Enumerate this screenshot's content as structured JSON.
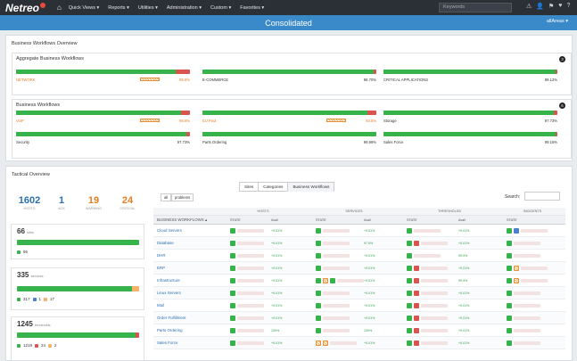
{
  "nav": {
    "logo": "Netreo",
    "menus": [
      "Quick Views ▾",
      "Reports ▾",
      "Utilities ▾",
      "Administration ▾",
      "Custom ▾",
      "Favorites ▾"
    ],
    "search_placeholder": "Keywords"
  },
  "header": {
    "title": "Consolidated",
    "right_link": "allAreas ▾"
  },
  "bwo": {
    "title": "Business Workflows Overview",
    "aggregate": {
      "title": "Aggregate Business Workflows",
      "count": "3",
      "items": [
        {
          "label": "NETWORK",
          "pct": "95.6%",
          "status": "warn",
          "fill": 0.92
        },
        {
          "label": "E-COMMERCE",
          "pct": "98.70%",
          "status": "ok",
          "fill": 0.987
        },
        {
          "label": "CRITICAL APPLICATIONS",
          "pct": "99.12%",
          "status": "ok",
          "fill": 0.99
        }
      ]
    },
    "workflows": {
      "title": "Business Workflows",
      "count": "6",
      "items": [
        {
          "label": "VoIP",
          "pct": "95.6%",
          "status": "warn",
          "fill": 0.95
        },
        {
          "label": "EU Pool",
          "pct": "93.5%",
          "status": "warn",
          "fill": 0.95
        },
        {
          "label": "Storage",
          "pct": "97.73%",
          "status": "ok",
          "fill": 0.977
        },
        {
          "label": "Security",
          "pct": "97.73%",
          "status": "ok",
          "fill": 0.977
        },
        {
          "label": "Parts Ordering",
          "pct": "99.99%",
          "status": "ok",
          "fill": 0.999
        },
        {
          "label": "Sales Force",
          "pct": "99.15%",
          "status": "ok",
          "fill": 0.99
        }
      ]
    }
  },
  "tactical": {
    "title": "Tactical Overview",
    "stats": [
      {
        "n": "1602",
        "label": "HOSTS",
        "color": "#2a6fb0"
      },
      {
        "n": "1",
        "label": "ACK",
        "color": "#2a6fb0"
      },
      {
        "n": "19",
        "label": "WARNING",
        "color": "#e67e22"
      },
      {
        "n": "24",
        "label": "CRITICAL",
        "color": "#e67e22"
      }
    ],
    "cards": [
      {
        "n": "66",
        "unit": "sites",
        "legend": [
          "66"
        ]
      },
      {
        "n": "335",
        "unit": "services",
        "legend": [
          "317",
          "1",
          "17"
        ]
      },
      {
        "n": "1245",
        "unit": "thresholds",
        "legend": [
          "1219",
          "24",
          "2"
        ]
      }
    ],
    "tabs": [
      "Sites",
      "Categories",
      "Business Workflows"
    ],
    "pills": [
      "all",
      "problems"
    ],
    "search_label": "Search:",
    "table": {
      "groups": [
        "HOSTS",
        "SERVICES",
        "THRESHOLDS",
        "INCIDENTS"
      ],
      "headers": [
        "BUSINESS WORKFLOWS",
        "STATE",
        "Avail",
        "STATE",
        "Avail",
        "STATE",
        "Avail",
        "STATE"
      ],
      "rows": [
        {
          "name": "Cloud Servers",
          "a": "+0.01%",
          "b": "+0.01%",
          "c": "+0.01%"
        },
        {
          "name": "Database",
          "a": "+0.01%",
          "b": "97.5%",
          "c": "+0.01%"
        },
        {
          "name": "DHR",
          "a": "+0.01%",
          "b": "+0.01%",
          "c": "99.9%"
        },
        {
          "name": "ERP",
          "a": "+0.01%",
          "b": "+0.01%",
          "c": "+0.01%"
        },
        {
          "name": "Infrastructure",
          "a": "+0.01%",
          "b": "+0.01%",
          "c": "99.9%"
        },
        {
          "name": "Linux Servers",
          "a": "+0.01%",
          "b": "+0.01%",
          "c": "+0.01%"
        },
        {
          "name": "Mail",
          "a": "+0.01%",
          "b": "+0.01%",
          "c": "+0.01%"
        },
        {
          "name": "Order Fulfillment",
          "a": "+0.01%",
          "b": "+0.01%",
          "c": "+0.01%"
        },
        {
          "name": "Parts Ordering",
          "a": "100%",
          "b": "100%",
          "c": "+0.01%"
        },
        {
          "name": "Sales Force",
          "a": "+0.01%",
          "b": "+0.01%",
          "c": "+0.01%"
        }
      ]
    }
  }
}
